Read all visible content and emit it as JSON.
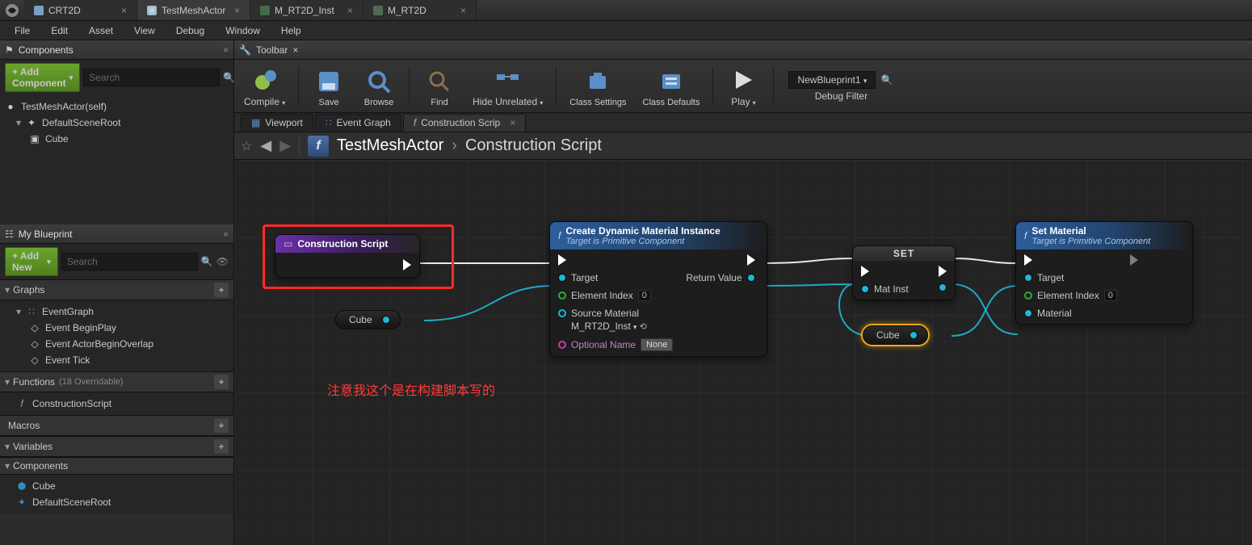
{
  "topTabs": [
    {
      "label": "CRT2D",
      "active": false
    },
    {
      "label": "TestMeshActor",
      "active": true
    },
    {
      "label": "M_RT2D_Inst",
      "active": false
    },
    {
      "label": "M_RT2D",
      "active": false
    }
  ],
  "menu": [
    "File",
    "Edit",
    "Asset",
    "View",
    "Debug",
    "Window",
    "Help"
  ],
  "components": {
    "title": "Components",
    "addBtn": "+ Add Component",
    "searchPlaceholder": "Search",
    "rows": [
      {
        "label": "TestMeshActor(self)",
        "indent": 0
      },
      {
        "label": "DefaultSceneRoot",
        "indent": 1
      },
      {
        "label": "Cube",
        "indent": 2
      }
    ]
  },
  "myBlueprint": {
    "title": "My Blueprint",
    "addNew": "+ Add New",
    "searchPlaceholder": "Search",
    "graphs": {
      "title": "Graphs",
      "eventGraph": "EventGraph",
      "children": [
        "Event BeginPlay",
        "Event ActorBeginOverlap",
        "Event Tick"
      ]
    },
    "functions": {
      "title": "Functions",
      "note": "(18 Overridable)",
      "rows": [
        "ConstructionScript"
      ]
    },
    "macros": {
      "title": "Macros"
    },
    "variables": {
      "title": "Variables"
    },
    "componentsSec": {
      "title": "Components",
      "rows": [
        "Cube",
        "DefaultSceneRoot"
      ]
    }
  },
  "toolbar": {
    "title": "Toolbar",
    "buttons": [
      "Compile",
      "Save",
      "Browse",
      "Find",
      "Hide Unrelated",
      "Class Settings",
      "Class Defaults",
      "Play"
    ],
    "debugSel": "NewBlueprint1",
    "debugLabel": "Debug Filter"
  },
  "subTabs": [
    {
      "label": "Viewport",
      "active": false
    },
    {
      "label": "Event Graph",
      "active": false
    },
    {
      "label": "Construction Scrip",
      "active": true
    }
  ],
  "breadcrumb": {
    "root": "TestMeshActor",
    "leaf": "Construction Script"
  },
  "nodes": {
    "construct": {
      "title": "Construction Script"
    },
    "cdmi": {
      "title": "Create Dynamic Material Instance",
      "sub": "Target is Primitive Component",
      "target": "Target",
      "elIdx": "Element Index",
      "elVal": "0",
      "srcMat": "Source Material",
      "srcVal": "M_RT2D_Inst",
      "optName": "Optional Name",
      "optVal": "None",
      "retVal": "Return Value"
    },
    "set": {
      "title": "SET",
      "matInst": "Mat Inst"
    },
    "setMat": {
      "title": "Set Material",
      "sub": "Target is Primitive Component",
      "target": "Target",
      "elIdx": "Element Index",
      "elVal": "0",
      "mat": "Material"
    },
    "cubeChip": "Cube"
  },
  "annotation": "注意我这个是在构建脚本写的"
}
